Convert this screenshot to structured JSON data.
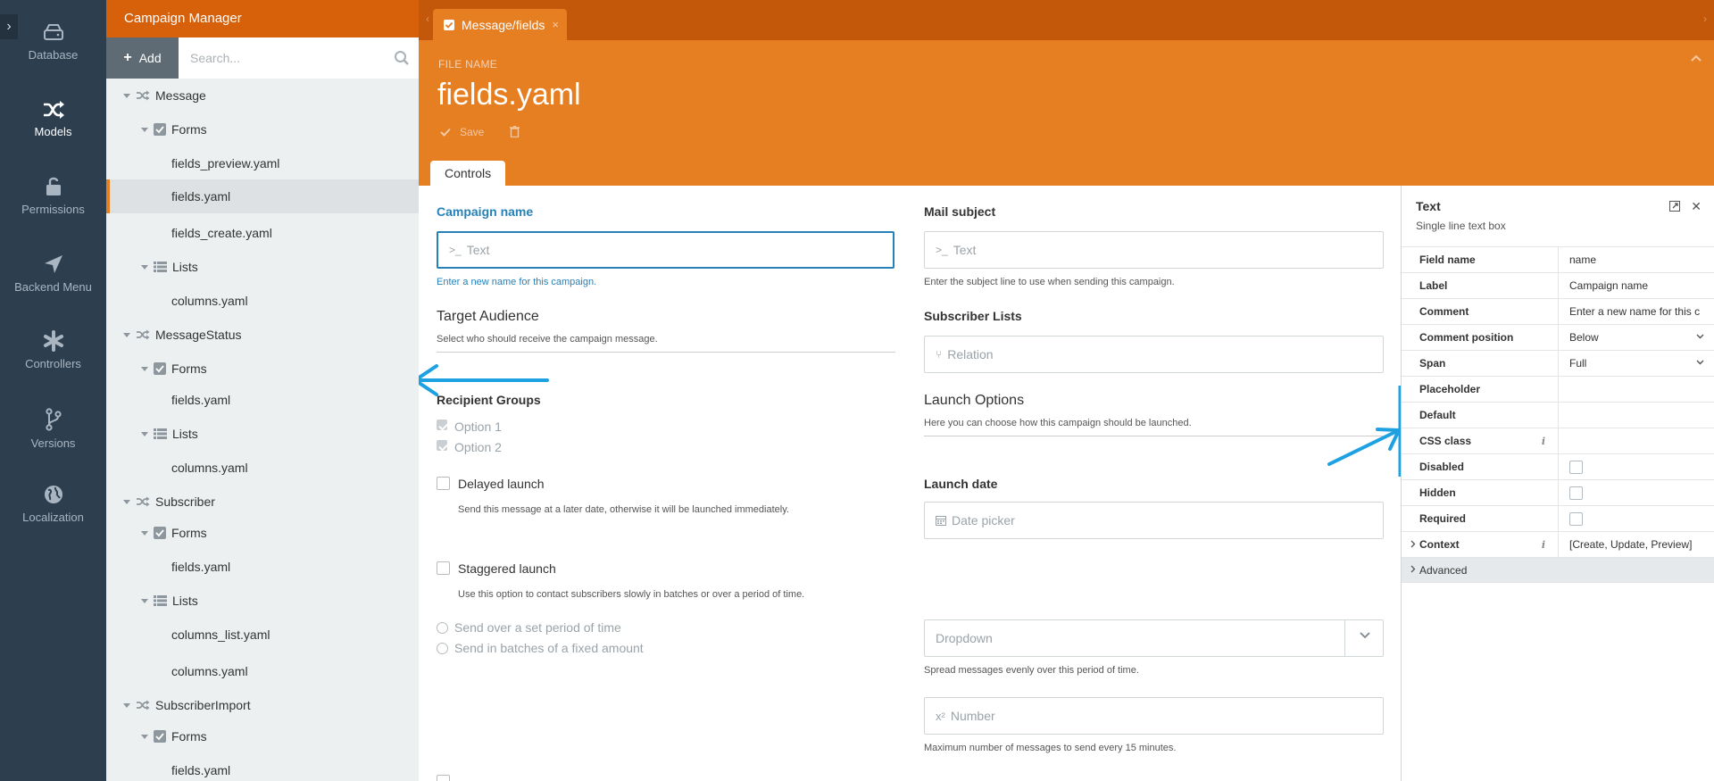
{
  "nav": {
    "items": [
      {
        "label": "Database",
        "icon": "database-icon"
      },
      {
        "label": "Models",
        "icon": "models-icon"
      },
      {
        "label": "Permissions",
        "icon": "lock-icon"
      },
      {
        "label": "Backend Menu",
        "icon": "paper-plane-icon"
      },
      {
        "label": "Controllers",
        "icon": "asterisk-icon"
      },
      {
        "label": "Versions",
        "icon": "branch-icon"
      },
      {
        "label": "Localization",
        "icon": "globe-icon"
      }
    ],
    "active": "Models"
  },
  "sidebar": {
    "title": "Campaign Manager",
    "add_label": "Add",
    "search_placeholder": "Search...",
    "tree": [
      {
        "label": "Message",
        "type": "model"
      },
      {
        "label": "Forms",
        "type": "forms"
      },
      {
        "label": "fields_preview.yaml",
        "type": "file"
      },
      {
        "label": "fields.yaml",
        "type": "file",
        "selected": true
      },
      {
        "label": "fields_create.yaml",
        "type": "file"
      },
      {
        "label": "Lists",
        "type": "lists"
      },
      {
        "label": "columns.yaml",
        "type": "file"
      },
      {
        "label": "MessageStatus",
        "type": "model"
      },
      {
        "label": "Forms",
        "type": "forms"
      },
      {
        "label": "fields.yaml",
        "type": "file"
      },
      {
        "label": "Lists",
        "type": "lists"
      },
      {
        "label": "columns.yaml",
        "type": "file"
      },
      {
        "label": "Subscriber",
        "type": "model"
      },
      {
        "label": "Forms",
        "type": "forms"
      },
      {
        "label": "fields.yaml",
        "type": "file"
      },
      {
        "label": "Lists",
        "type": "lists"
      },
      {
        "label": "columns_list.yaml",
        "type": "file"
      },
      {
        "label": "columns.yaml",
        "type": "file"
      },
      {
        "label": "SubscriberImport",
        "type": "model"
      },
      {
        "label": "Forms",
        "type": "forms"
      },
      {
        "label": "fields.yaml",
        "type": "file"
      }
    ]
  },
  "tab": {
    "label": "Message/fields"
  },
  "file": {
    "label": "FILE NAME",
    "name": "fields.yaml",
    "save_label": "Save"
  },
  "controls_tab": "Controls",
  "form": {
    "campaign_name": {
      "label": "Campaign name",
      "placeholder": "Text",
      "hint": "Enter a new name for this campaign."
    },
    "mail_subject": {
      "label": "Mail subject",
      "placeholder": "Text",
      "hint": "Enter the subject line to use when sending this campaign."
    },
    "target_audience": {
      "title": "Target Audience",
      "hint": "Select who should receive the campaign message."
    },
    "subscriber_lists": {
      "label": "Subscriber Lists",
      "placeholder": "Relation"
    },
    "recipient_groups": {
      "label": "Recipient Groups",
      "options": [
        "Option 1",
        "Option 2"
      ]
    },
    "launch_options": {
      "title": "Launch Options",
      "hint": "Here you can choose how this campaign should be launched."
    },
    "delayed_launch": {
      "label": "Delayed launch",
      "hint": "Send this message at a later date, otherwise it will be launched immediately."
    },
    "launch_date": {
      "label": "Launch date",
      "placeholder": "Date picker"
    },
    "staggered_launch": {
      "label": "Staggered launch",
      "hint": "Use this option to contact subscribers slowly in batches or over a period of time."
    },
    "radios": [
      "Send over a set period of time",
      "Send in batches of a fixed amount"
    ],
    "dropdown": {
      "placeholder": "Dropdown",
      "hint": "Spread messages evenly over this period of time."
    },
    "number": {
      "placeholder": "Number",
      "prefix": "x²",
      "hint": "Maximum number of messages to send every 15 minutes."
    }
  },
  "inspector": {
    "title": "Text",
    "subtitle": "Single line text box",
    "rows": [
      {
        "name": "Field name",
        "value": "name"
      },
      {
        "name": "Label",
        "value": "Campaign name"
      },
      {
        "name": "Comment",
        "value": "Enter a new name for this c"
      },
      {
        "name": "Comment position",
        "value": "Below"
      },
      {
        "name": "Span",
        "value": "Full"
      },
      {
        "name": "Placeholder",
        "value": ""
      },
      {
        "name": "Default",
        "value": ""
      },
      {
        "name": "CSS class",
        "value": ""
      },
      {
        "name": "Disabled",
        "value": ""
      },
      {
        "name": "Hidden",
        "value": ""
      },
      {
        "name": "Required",
        "value": ""
      },
      {
        "name": "Context",
        "value": "[Create, Update, Preview]"
      },
      {
        "name": "Advanced",
        "value": ""
      }
    ]
  },
  "colors": {
    "nav_bg": "#2d3e4f",
    "sidebar_header": "#d7600b",
    "orange": "#e67e22",
    "tabbar": "#c3580a",
    "accent_blue": "#2581b8",
    "annotation_blue": "#1da1e2"
  }
}
